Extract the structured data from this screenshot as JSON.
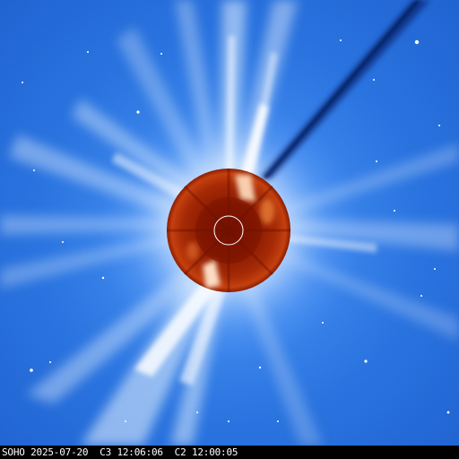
{
  "caption": "SOHO 2025-07-20  C3 12:06:06  C2 12:00:05",
  "colors": {
    "sky_outer": "#1a63d6",
    "sky_inner": "#3a86ee",
    "streamer": "#eaf4ff",
    "occulter_dark": "#7a1300",
    "occulter_mid": "#a62a06",
    "occulter_hot": "#ff9a4a",
    "comet_tail": "#0a2a7a",
    "sun_outline": "#ffffff",
    "caption_bg": "#000000",
    "caption_text": "#ffffff"
  }
}
